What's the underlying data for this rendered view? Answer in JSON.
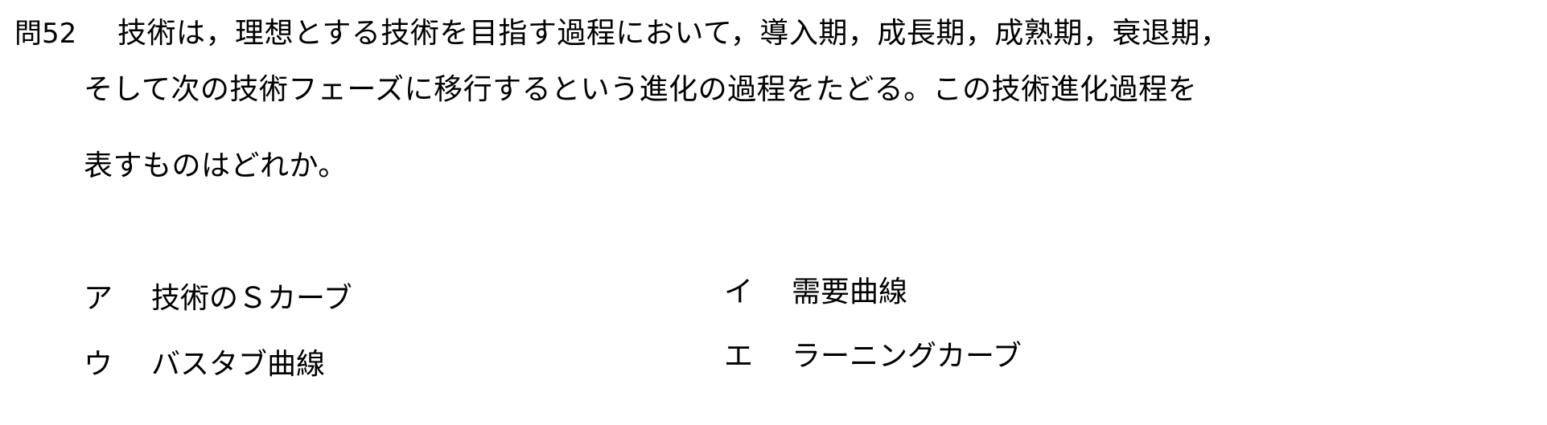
{
  "question": {
    "number": "問52",
    "line1": "技術は，理想とする技術を目指す過程において，導入期，成長期，成熟期，衰退期，",
    "line2": "そして次の技術フェーズに移行するという進化の過程をたどる。この技術進化過程を",
    "line3": "表すものはどれか。"
  },
  "options": {
    "a": {
      "label": "ア",
      "text": "技術のＳカーブ"
    },
    "i": {
      "label": "イ",
      "text": "需要曲線"
    },
    "u": {
      "label": "ウ",
      "text": "バスタブ曲線"
    },
    "e": {
      "label": "エ",
      "text": "ラーニングカーブ"
    }
  }
}
